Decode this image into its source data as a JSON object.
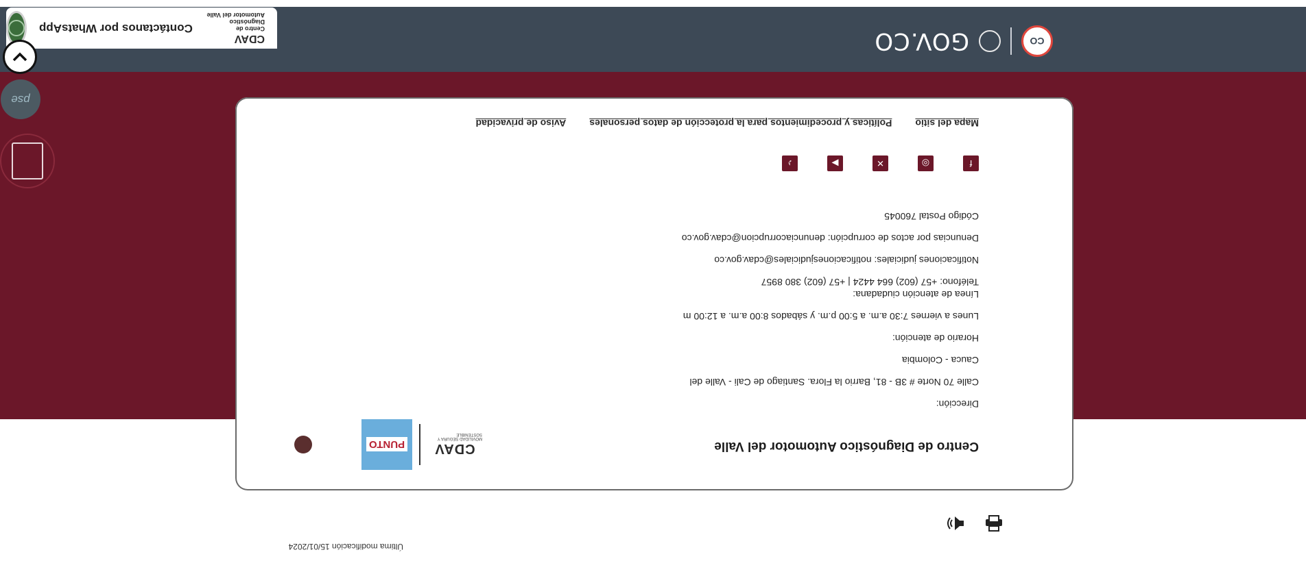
{
  "header": {
    "co_badge": "CO",
    "gov_text": "GOV.CO",
    "colors": {
      "header_bg": "#3d4956",
      "band_bg": "#6b1729"
    }
  },
  "whatsapp_widget": {
    "logo_text": "CDAV",
    "logo_subtitle": "Centro de Diagnóstico Automotor del Valle",
    "label": "Contáctanos por WhatsApp",
    "icon": "whatsapp-icon"
  },
  "side_buttons": {
    "pse_label": "pse",
    "chevron_icon": "chevron-down-icon",
    "pqrs_icon": "document-icon"
  },
  "footer": {
    "title": "Centro de Diagnóstico Automotor del Valle",
    "logos": {
      "cdav": "CDAV",
      "cdav_subtitle": "MOVILIDAD SEGURA Y SOSTENIBLE",
      "punto": "PUNTO"
    },
    "contact_lines": {
      "address_label": "Dirección:",
      "address_1": "Calle 70 Norte # 3B - 81, Barrio la Flora. Santiago de Cali - Valle del",
      "address_2": "Cauca - Colombia",
      "hours_label": "Horario de atención:",
      "hours": "Lunes a viernes 7:30 a.m. a 5:00 p.m. y sábados 8:00 a.m. a 12:00 m",
      "line_label": "Línea de atención ciudadana:",
      "phone": "Teléfono: +57 (602) 664 4424  |  +57 (602) 380 8957",
      "notifications": "Notificaciones judiciales: notificacionesjudiciales@cdav.gov.co",
      "complaints": "Denuncias por actos de corrupción: denunciacorrupcion@cdav.gov.co",
      "postal": "Código Postal 760045"
    },
    "socials": [
      {
        "name": "facebook",
        "glyph": "f"
      },
      {
        "name": "instagram",
        "glyph": "◎"
      },
      {
        "name": "x-twitter",
        "glyph": "✕"
      },
      {
        "name": "youtube",
        "glyph": "▶"
      },
      {
        "name": "tiktok",
        "glyph": "♪"
      }
    ],
    "links": {
      "sitemap": "Mapa del sitio",
      "data_policy": "Políticas y procedimientos para la protección de datos personales",
      "privacy": "Aviso de privacidad"
    }
  },
  "page_tools": {
    "print_icon": "printer-icon",
    "audio_icon": "speaker-icon"
  },
  "last_modified": "Última modificación 15/01/2024"
}
